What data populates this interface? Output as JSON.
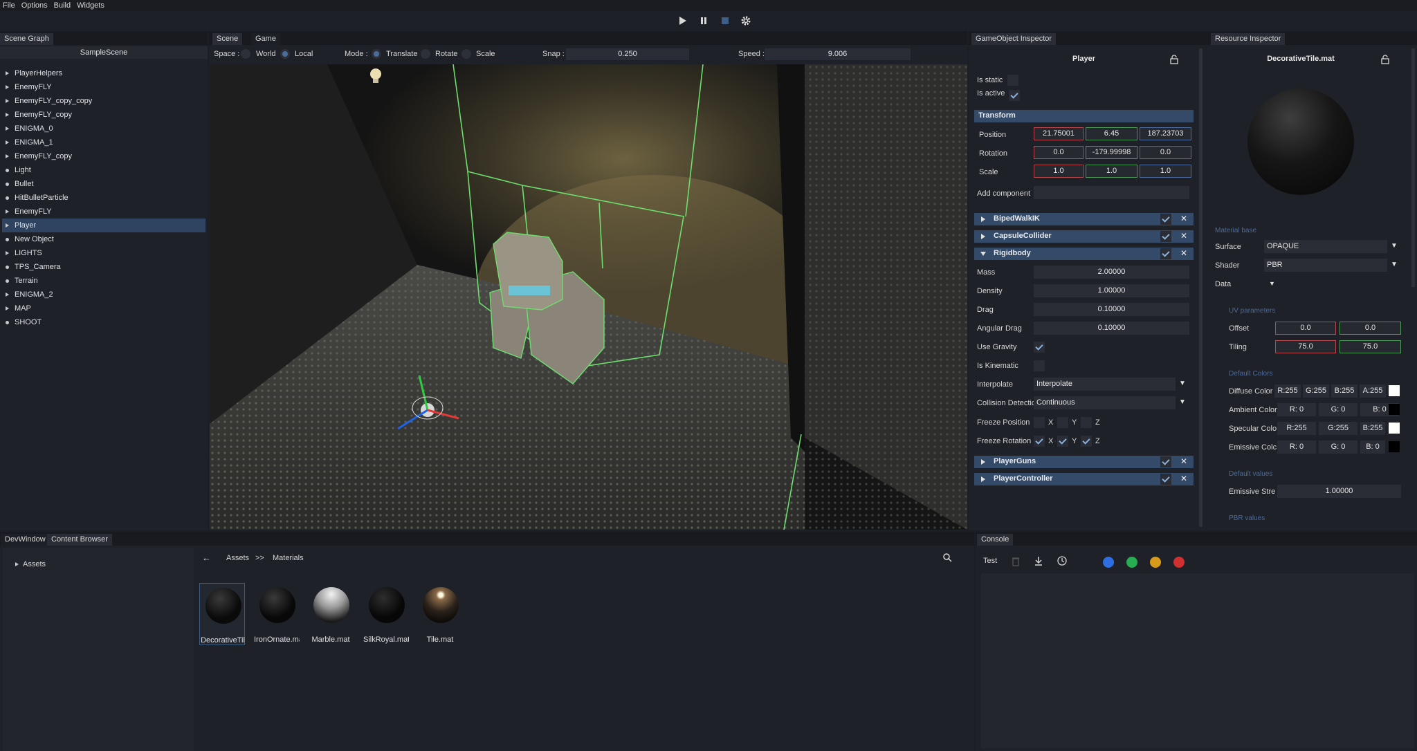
{
  "menu": [
    "File",
    "Options",
    "Build",
    "Widgets"
  ],
  "scene_graph": {
    "tab": "Scene Graph",
    "scene_name": "SampleScene",
    "items": [
      {
        "label": "PlayerHelpers",
        "expandable": true
      },
      {
        "label": "EnemyFLY",
        "expandable": true
      },
      {
        "label": "EnemyFLY_copy_copy",
        "expandable": true
      },
      {
        "label": "EnemyFLY_copy",
        "expandable": true
      },
      {
        "label": "ENIGMA_0",
        "expandable": true
      },
      {
        "label": "ENIGMA_1",
        "expandable": true
      },
      {
        "label": "EnemyFLY_copy",
        "expandable": true
      },
      {
        "label": "Light",
        "expandable": false
      },
      {
        "label": "Bullet",
        "expandable": false
      },
      {
        "label": "HitBulletParticle",
        "expandable": false
      },
      {
        "label": "EnemyFLY",
        "expandable": true
      },
      {
        "label": "Player",
        "expandable": true,
        "selected": true
      },
      {
        "label": "New Object",
        "expandable": false
      },
      {
        "label": "LIGHTS",
        "expandable": true
      },
      {
        "label": "TPS_Camera",
        "expandable": false
      },
      {
        "label": "Terrain",
        "expandable": false
      },
      {
        "label": "ENIGMA_2",
        "expandable": true
      },
      {
        "label": "MAP",
        "expandable": true
      },
      {
        "label": "SHOOT",
        "expandable": false
      }
    ]
  },
  "viewport": {
    "tabs": [
      "Scene",
      "Game"
    ],
    "space_label": "Space :",
    "space_world": "World",
    "space_local": "Local",
    "mode_label": "Mode :",
    "mode_translate": "Translate",
    "mode_rotate": "Rotate",
    "mode_scale": "Scale",
    "snap_label": "Snap :",
    "snap_value": "0.250",
    "speed_label": "Speed :",
    "speed_value": "9.006"
  },
  "inspector": {
    "tab": "GameObject Inspector",
    "object_name": "Player",
    "is_static": "Is static",
    "is_active": "Is active",
    "transform_header": "Transform",
    "position_label": "Position",
    "position": [
      "21.75001",
      "6.45",
      "187.23703"
    ],
    "rotation_label": "Rotation",
    "rotation": [
      "0.0",
      "-179.99998",
      "0.0"
    ],
    "scale_label": "Scale",
    "scale": [
      "1.0",
      "1.0",
      "1.0"
    ],
    "add_component": "Add component",
    "components": {
      "biped": "BipedWalkIK",
      "capsule": "CapsuleCollider",
      "rigidbody": "Rigidbody",
      "guns": "PlayerGuns",
      "controller": "PlayerController"
    },
    "rigidbody": {
      "mass_label": "Mass",
      "mass": "2.00000",
      "density_label": "Density",
      "density": "1.00000",
      "drag_label": "Drag",
      "drag": "0.10000",
      "angular_label": "Angular Drag",
      "angular": "0.10000",
      "gravity_label": "Use Gravity",
      "kinematic_label": "Is Kinematic",
      "interpolate_label": "Interpolate",
      "interpolate": "Interpolate",
      "collision_label": "Collision Detectic",
      "collision": "Continuous",
      "freeze_pos_label": "Freeze Position",
      "freeze_rot_label": "Freeze Rotation",
      "x": "X",
      "y": "Y",
      "z": "Z"
    }
  },
  "resource": {
    "tab": "Resource Inspector",
    "name": "DecorativeTile.mat",
    "material_base": "Material base",
    "surface_label": "Surface",
    "surface": "OPAQUE",
    "shader_label": "Shader",
    "shader": "PBR",
    "data_label": "Data",
    "uv_header": "UV parameters",
    "offset_label": "Offset",
    "offset": [
      "0.0",
      "0.0"
    ],
    "tiling_label": "Tiling",
    "tiling": [
      "75.0",
      "75.0"
    ],
    "colors_header": "Default Colors",
    "diffuse_label": "Diffuse Color",
    "diffuse": [
      "R:255",
      "G:255",
      "B:255",
      "A:255"
    ],
    "ambient_label": "Ambient Color",
    "ambient": [
      "R: 0",
      "G: 0",
      "B: 0"
    ],
    "specular_label": "Specular Colo",
    "specular": [
      "R:255",
      "G:255",
      "B:255"
    ],
    "emissive_label": "Emissive Colc",
    "emissive": [
      "R: 0",
      "G: 0",
      "B: 0"
    ],
    "values_header": "Default values",
    "emissive_str_label": "Emissive Stre",
    "emissive_str": "1.00000",
    "pbr_header": "PBR values"
  },
  "bottom": {
    "tabs": [
      "DevWindow",
      "Content Browser"
    ],
    "tree_root": "Assets",
    "breadcrumb": [
      "Assets",
      ">>",
      "Materials"
    ],
    "assets": [
      "DecorativeTil",
      "IronOrnate.ma",
      "Marble.mat",
      "SilkRoyal.mat",
      "Tile.mat"
    ]
  },
  "console": {
    "tab": "Console",
    "filter": "Test"
  },
  "colors": {
    "accent": "#334b69",
    "selection": "#2e4460",
    "x_axis": "#b8484e",
    "y_axis": "#4c9b58",
    "z_axis": "#4a6aa0"
  }
}
